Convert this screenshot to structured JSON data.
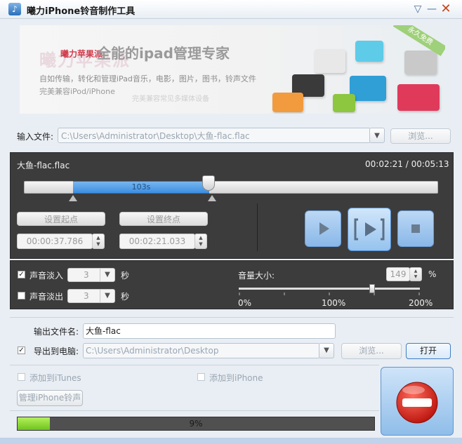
{
  "window": {
    "title": "曦力iPhone铃音制作工具",
    "icon_name": "music-note-icon"
  },
  "banner": {
    "brand": "曦力苹果派",
    "ghost_brand": "曦力苹果派",
    "headline": "全能的ipad管理专家",
    "line1": "自如传输，转化和管理iPad音乐，电影，图片，图书，铃声文件",
    "line2": "完美兼容iPod/iPhone",
    "ghost_line": "完美兼容常见多媒体设备",
    "tag": "永久免费"
  },
  "input": {
    "label": "输入文件:",
    "path": "C:\\Users\\Administrator\\Desktop\\大鱼-flac.flac",
    "browse_label": "浏览..."
  },
  "player": {
    "file_name": "大鱼-flac.flac",
    "current_time": "00:02:21",
    "separator": "/",
    "total_time": "00:05:13",
    "selection_length": "103s",
    "set_start_label": "设置起点",
    "set_end_label": "设置终点",
    "start_time": "00:00:37.786",
    "end_time": "00:02:21.033",
    "selection_start_fraction": 0.121,
    "selection_end_fraction": 0.45
  },
  "options": {
    "fade_in_label": "声音淡入",
    "fade_in_checked": true,
    "fade_in_value": "3",
    "fade_out_label": "声音淡出",
    "fade_out_checked": false,
    "fade_out_value": "3",
    "seconds_unit": "秒",
    "volume_label": "音量大小:",
    "volume_value": "149",
    "percent_unit": "%",
    "volume_min": "0%",
    "volume_mid": "100%",
    "volume_max": "200%"
  },
  "output": {
    "name_label": "输出文件名:",
    "name_value": "大鱼-flac",
    "export_label": "导出到电脑:",
    "export_checked": true,
    "export_path": "C:\\Users\\Administrator\\Desktop",
    "browse_label": "浏览...",
    "open_label": "打开"
  },
  "itunes": {
    "add_itunes_label": "添加到iTunes",
    "add_iphone_label": "添加到iPhone",
    "manage_label": "管理iPhone铃声"
  },
  "progress": {
    "text": "9%",
    "fraction": 0.09
  },
  "colors": {
    "accent": "#3d8ee0",
    "stop": "#d8261f",
    "progress": "#7fd02a"
  }
}
